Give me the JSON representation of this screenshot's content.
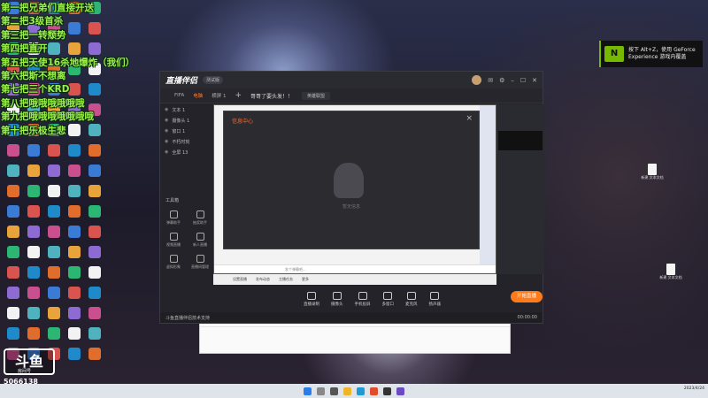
{
  "danmaku": [
    "第一把兄弟们直接开送",
    "第二把3级首杀",
    "第三把一转颓势",
    "第四把直开",
    "第五把天使16杀地爆炸（我们）",
    "第六把斯不想离",
    "第七把三个KRD",
    "第八把哦哦哦哦哦哦",
    "第九把哦哦哦哦哦哦哦",
    "第十把乐极生悲"
  ],
  "watermark": {
    "logo": "斗鱼",
    "sub": "房间号",
    "room": "5066138"
  },
  "nvidia": {
    "logo": "N",
    "text": "按下 Alt+Z，使用 GeForce Experience 游戏内覆盖"
  },
  "desktop_files": [
    {
      "label": "新建 文本文档"
    },
    {
      "label": ""
    },
    {
      "label": "新建 文本文档"
    }
  ],
  "colors": {
    "accent": "#ff7a1a",
    "danmaku": "#9cf24a",
    "nvidia": "#76b900"
  },
  "app": {
    "logo": "直播伴侣",
    "version": "测试版",
    "title_icons": [
      "avatar",
      "mail-icon",
      "gear-icon",
      "minimize-icon",
      "maximize-icon",
      "close-icon"
    ],
    "tabs": [
      "FIFA",
      "电脑",
      "横屏 1"
    ],
    "active_tab": 1,
    "plus": "+",
    "live_title": "哥哥了要头发！！",
    "category": "英雄联盟",
    "scenes": [
      {
        "label": "文本 1"
      },
      {
        "label": "摄像头 1"
      },
      {
        "label": "窗口 1"
      },
      {
        "label": "不朽时刻"
      },
      {
        "label": "全屏 13"
      }
    ],
    "tools_label": "工具箱",
    "tools": [
      {
        "label": "弹幕助手"
      },
      {
        "label": "抽奖助手"
      },
      {
        "label": "视频直播"
      },
      {
        "label": "新人直播"
      },
      {
        "label": "虚拟形象"
      },
      {
        "label": "直播间管理"
      }
    ],
    "dialog": {
      "title": "信息中心",
      "close": "×",
      "empty": "暂无信息"
    },
    "chat_placeholder": "发个弹幕吧...",
    "preview_bottom": [
      "设置直播",
      "发布动态",
      "主播任务",
      "更多"
    ],
    "controls": [
      {
        "label": "直播录制"
      },
      {
        "label": "摄像头"
      },
      {
        "label": "手机投屏"
      },
      {
        "label": "多窗口"
      },
      {
        "label": "麦克风"
      },
      {
        "label": "扬声器"
      }
    ],
    "start_button": "开始直播",
    "status_left": "斗鱼直播伴侣技术支持",
    "status_right": "00:00:00"
  },
  "taskbar": {
    "time": "2023/4/24"
  }
}
